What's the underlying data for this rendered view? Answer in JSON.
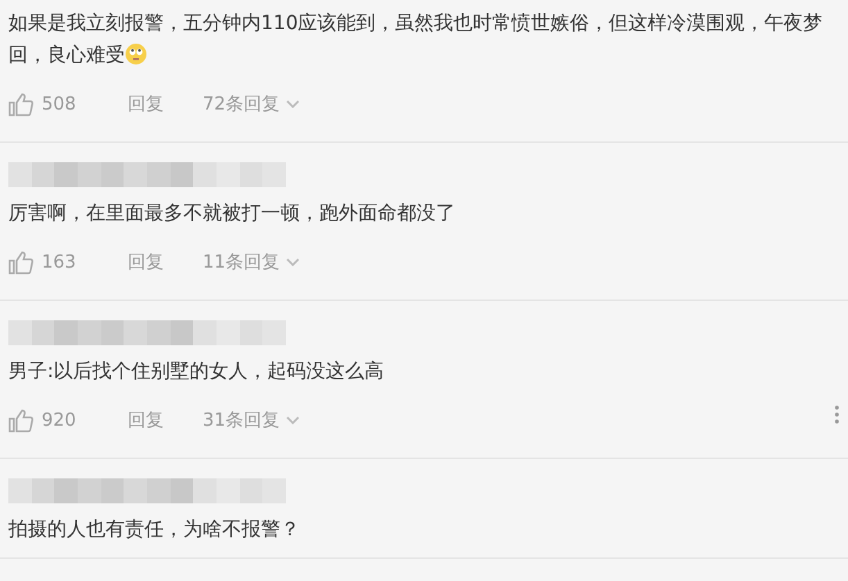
{
  "comments": [
    {
      "text": "如果是我立刻报警，五分钟内110应该能到，虽然我也时常愤世嫉俗，但这样冷漠围观，午夜梦回，良心难受",
      "end_emoji": true,
      "likes": "508",
      "reply": "回复",
      "replies": "72条回复"
    },
    {
      "author_hidden": true,
      "text": "厉害啊，在里面最多不就被打一顿，跑外面命都没了",
      "likes": "163",
      "reply": "回复",
      "replies": "11条回复"
    },
    {
      "author_hidden": true,
      "text": "男子:以后找个住别墅的女人，起码没这么高",
      "likes": "920",
      "reply": "回复",
      "replies": "31条回复",
      "menu": true
    },
    {
      "author_hidden": true,
      "text": "拍摄的人也有责任，为啥不报警？"
    }
  ]
}
